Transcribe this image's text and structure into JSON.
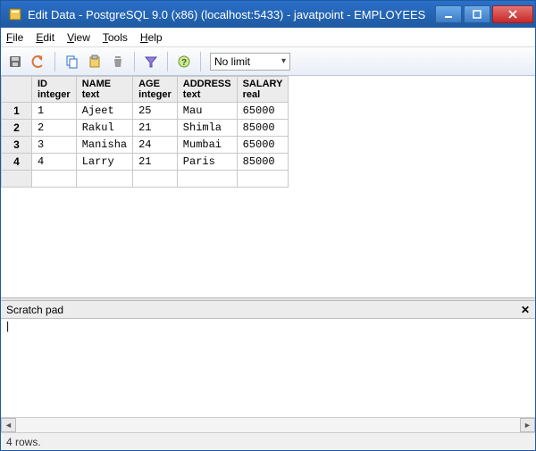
{
  "window": {
    "title": "Edit Data - PostgreSQL 9.0 (x86) (localhost:5433) - javatpoint - EMPLOYEES"
  },
  "menu": {
    "file": "File",
    "edit": "Edit",
    "view": "View",
    "tools": "Tools",
    "help": "Help"
  },
  "toolbar": {
    "limit": "No limit"
  },
  "columns": [
    {
      "name": "ID",
      "type": "integer"
    },
    {
      "name": "NAME",
      "type": "text"
    },
    {
      "name": "AGE",
      "type": "integer"
    },
    {
      "name": "ADDRESS",
      "type": "text"
    },
    {
      "name": "SALARY",
      "type": "real"
    }
  ],
  "rows": [
    {
      "n": "1",
      "ID": "1",
      "NAME": "Ajeet",
      "AGE": "25",
      "ADDRESS": "Mau",
      "SALARY": "65000"
    },
    {
      "n": "2",
      "ID": "2",
      "NAME": "Rakul",
      "AGE": "21",
      "ADDRESS": "Shimla",
      "SALARY": "85000"
    },
    {
      "n": "3",
      "ID": "3",
      "NAME": "Manisha",
      "AGE": "24",
      "ADDRESS": "Mumbai",
      "SALARY": "65000"
    },
    {
      "n": "4",
      "ID": "4",
      "NAME": "Larry",
      "AGE": "21",
      "ADDRESS": "Paris",
      "SALARY": "85000"
    }
  ],
  "scratch": {
    "title": "Scratch pad",
    "content": ""
  },
  "status": {
    "rows": "4 rows."
  }
}
